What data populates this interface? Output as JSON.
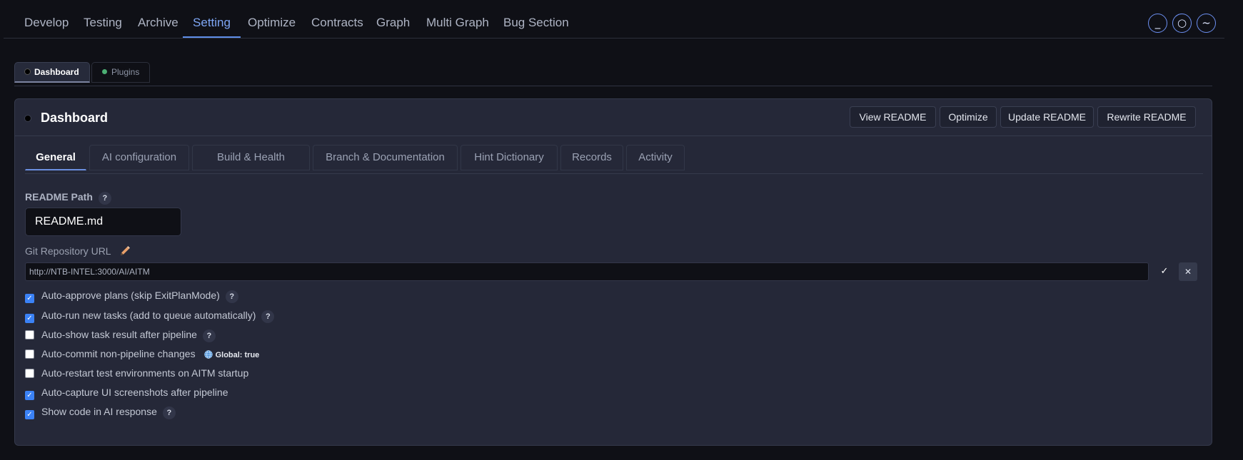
{
  "topnav": {
    "tabs": [
      "Develop",
      "Testing",
      "Archive",
      "Setting",
      "Optimize",
      "Contracts",
      "Graph",
      "Multi Graph",
      "Bug Section"
    ],
    "active_index": 3,
    "window_buttons": [
      "_",
      "○",
      "~"
    ]
  },
  "subtabs": [
    {
      "label": "Dashboard",
      "dot_color": "#000000"
    },
    {
      "label": "Plugins",
      "dot_color": "#4caf74"
    }
  ],
  "panel": {
    "title": "Dashboard",
    "buttons": [
      "View README",
      "Optimize",
      "Update README",
      "Rewrite README"
    ],
    "tabs": [
      "General",
      "AI configuration",
      "Build & Health",
      "Branch & Documentation",
      "Hint Dictionary",
      "Records",
      "Activity"
    ],
    "active_tab": 0
  },
  "form": {
    "readme_label": "README Path",
    "readme_value": "README.md",
    "git_label": "Git Repository URL",
    "git_value": "http://NTB-INTEL:3000/AI/AITM",
    "help_glyph": "?",
    "confirm_glyph": "✓",
    "cancel_glyph": "✕",
    "checkboxes": [
      {
        "label": "Auto-approve plans (skip ExitPlanMode)",
        "checked": true,
        "help": true
      },
      {
        "label": "Auto-run new tasks (add to queue automatically)",
        "checked": true,
        "help": true
      },
      {
        "label": "Auto-show task result after pipeline",
        "checked": false,
        "help": true
      },
      {
        "label": "Auto-commit non-pipeline changes",
        "checked": false,
        "help": false,
        "badge": "Global: true"
      },
      {
        "label": "Auto-restart test environments on AITM startup",
        "checked": false,
        "help": false
      },
      {
        "label": "Auto-capture UI screenshots after pipeline",
        "checked": true,
        "help": false
      },
      {
        "label": "Show code in AI response",
        "checked": true,
        "help": true
      }
    ]
  },
  "colors": {
    "accent": "#7ea6f4",
    "checkbox_on": "#3b82f6",
    "background": "#0f1016",
    "panel": "#252838"
  }
}
